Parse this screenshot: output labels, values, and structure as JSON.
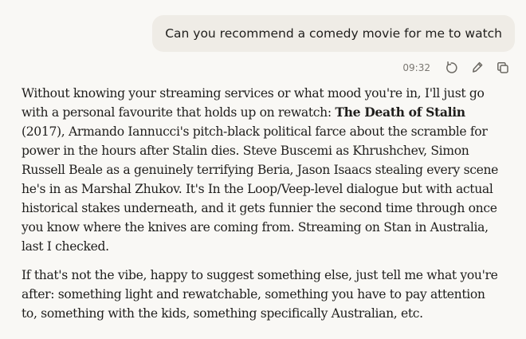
{
  "user_message": {
    "text": "Can you recommend a comedy movie for me to watch"
  },
  "message_meta": {
    "timestamp": "09:32",
    "icons": [
      "retry-icon",
      "edit-icon",
      "copy-icon"
    ]
  },
  "assistant_reply": {
    "paragraph1": {
      "part1": "Without knowing your streaming services or what mood you're in, I'll just go with a personal favourite that holds up on rewatch: ",
      "title": "The Death of Stalin",
      "part2": " (2017), Armando Iannucci's pitch-black political farce about the scramble for power in the hours after Stalin dies. Steve Buscemi as Khrushchev, Simon Russell Beale as a genuinely terrifying Beria, Jason Isaacs stealing every scene he's in as Marshal Zhukov. It's In the Loop/Veep-level dialogue but with actual historical stakes underneath, and it gets funnier the second time through once you know where the knives are coming from. Streaming on Stan in Australia, last I checked."
    },
    "paragraph2": "If that's not the vibe, happy to suggest something else, just tell me what you're after: something light and rewatchable, something you have to pay attention to, something with the kids, something specifically Australian, etc."
  }
}
